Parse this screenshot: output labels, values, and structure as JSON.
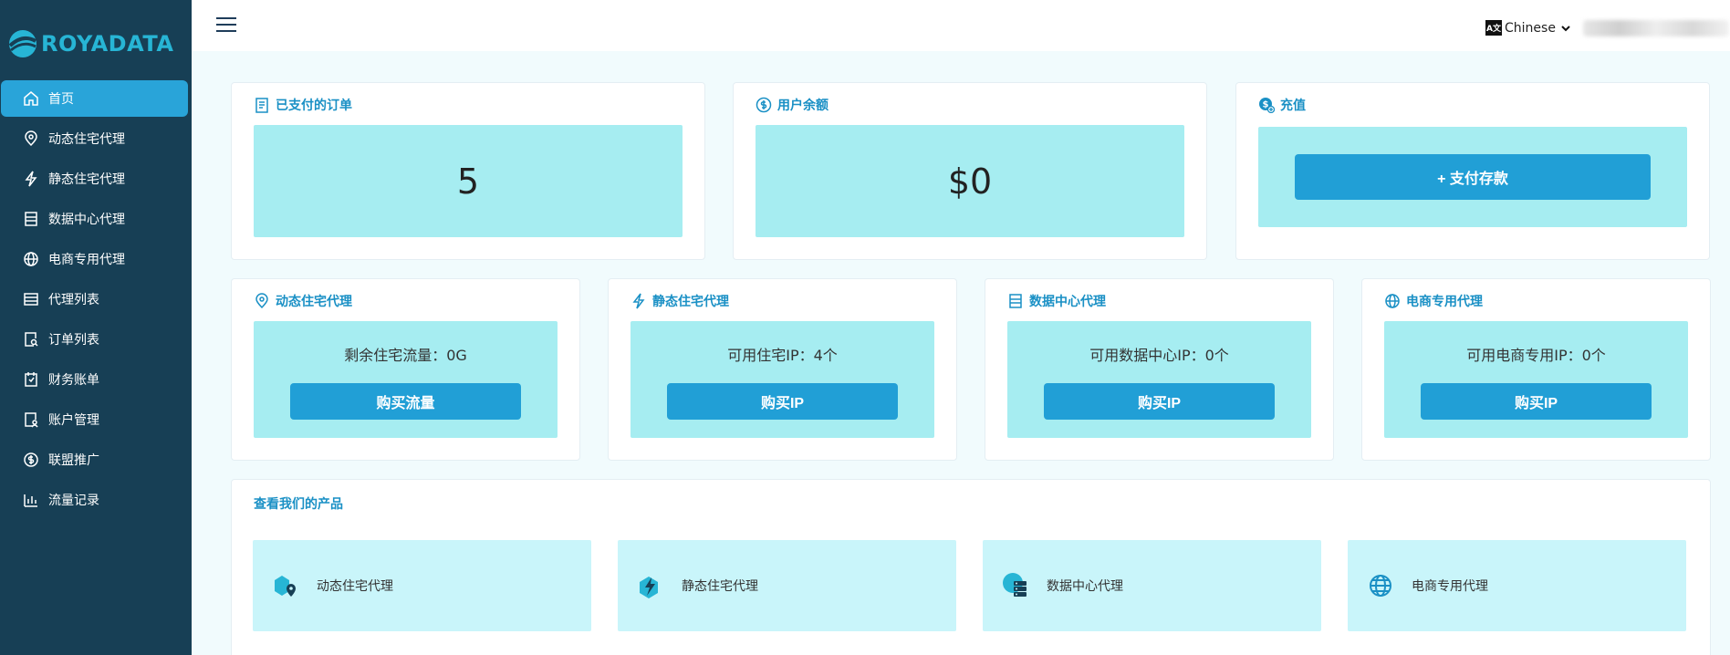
{
  "brand": {
    "name": "ROYADATA"
  },
  "sidebar": {
    "items": [
      {
        "label": "首页",
        "icon": "home-icon",
        "active": true
      },
      {
        "label": "动态住宅代理",
        "icon": "location-pin-icon"
      },
      {
        "label": "静态住宅代理",
        "icon": "lightning-icon"
      },
      {
        "label": "数据中心代理",
        "icon": "server-icon"
      },
      {
        "label": "电商专用代理",
        "icon": "globe-icon"
      },
      {
        "label": "代理列表",
        "icon": "list-icon"
      },
      {
        "label": "订单列表",
        "icon": "order-search-icon"
      },
      {
        "label": "财务账单",
        "icon": "bill-icon"
      },
      {
        "label": "账户管理",
        "icon": "account-icon"
      },
      {
        "label": "联盟推广",
        "icon": "dollar-icon"
      },
      {
        "label": "流量记录",
        "icon": "bar-chart-icon"
      }
    ]
  },
  "topbar": {
    "language": "Chinese",
    "lang_icon_text": "A文"
  },
  "stats": {
    "paid_orders": {
      "title": "已支付的订单",
      "value": "5"
    },
    "balance": {
      "title": "用户余额",
      "value": "$0"
    },
    "recharge": {
      "title": "充值",
      "button": "+ 支付存款"
    }
  },
  "products": [
    {
      "title": "动态住宅代理",
      "text": "剩余住宅流量：0G",
      "button": "购买流量"
    },
    {
      "title": "静态住宅代理",
      "text": "可用住宅IP：4个",
      "button": "购买IP"
    },
    {
      "title": "数据中心代理",
      "text": "可用数据中心IP：0个",
      "button": "购买IP"
    },
    {
      "title": "电商专用代理",
      "text": "可用电商专用IP：0个",
      "button": "购买IP"
    }
  ],
  "catalog": {
    "title": "查看我们的产品",
    "tiles": [
      {
        "label": "动态住宅代理"
      },
      {
        "label": "静态住宅代理"
      },
      {
        "label": "数据中心代理"
      },
      {
        "label": "电商专用代理"
      }
    ]
  },
  "colors": {
    "sidebar": "#173f55",
    "accent": "#219fd6",
    "stat_box": "#a6edf1",
    "tile": "#c9f5fa",
    "title": "#1a90c5"
  }
}
